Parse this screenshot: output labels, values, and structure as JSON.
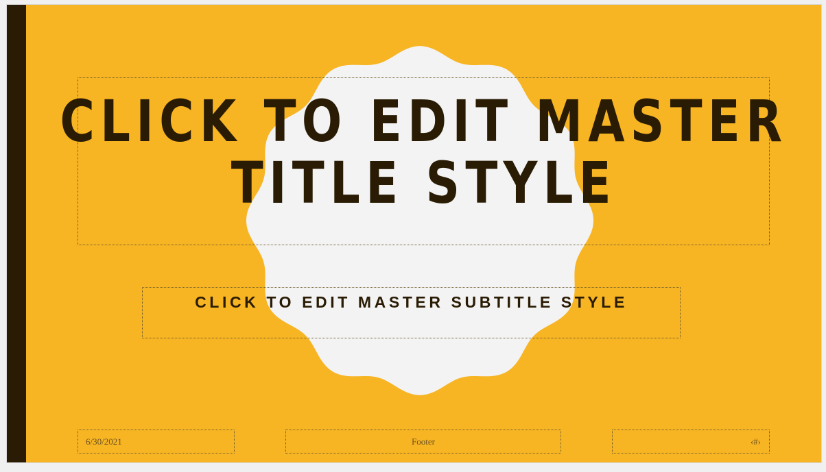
{
  "slide": {
    "title": "CLICK TO EDIT MASTER TITLE STYLE",
    "title_line1": "CLICK TO EDIT MASTER",
    "title_line2": "TITLE STYLE",
    "subtitle": "CLICK TO EDIT MASTER SUBTITLE STYLE",
    "date": "6/30/2021",
    "footer": "Footer",
    "slide_number": "‹#›"
  },
  "colors": {
    "background": "#f7b423",
    "accent_bar": "#2a1c04",
    "badge": "#f3f3f3",
    "text": "#2a1c04",
    "footer_text": "#6b5320"
  }
}
